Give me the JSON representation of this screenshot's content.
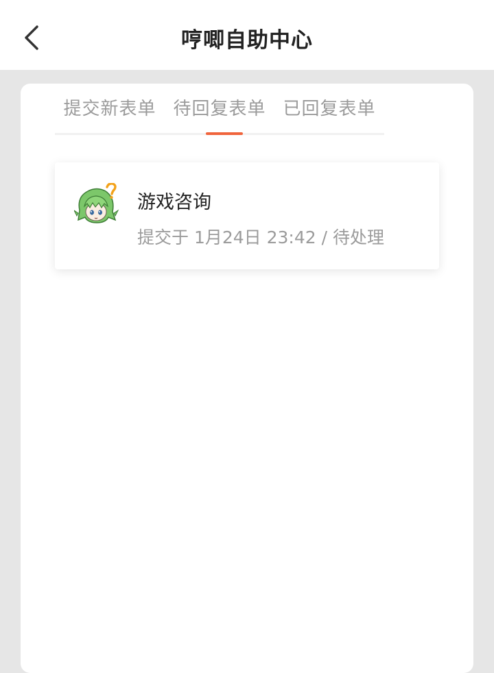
{
  "header": {
    "title": "哼唧自助中心",
    "back_icon": "chevron-left-icon"
  },
  "tabs": [
    {
      "label": "提交新表单",
      "active": false
    },
    {
      "label": "待回复表单",
      "active": true
    },
    {
      "label": "已回复表单",
      "active": false
    }
  ],
  "colors": {
    "accent": "#f0643c",
    "background": "#e6e6e6",
    "panel": "#ffffff",
    "muted_text": "#9b9b9b"
  },
  "tickets": [
    {
      "avatar_icon": "green-haired-mascot-question-icon",
      "title": "游戏咨询",
      "meta": "提交于 1月24日 23:42 / 待处理"
    }
  ]
}
